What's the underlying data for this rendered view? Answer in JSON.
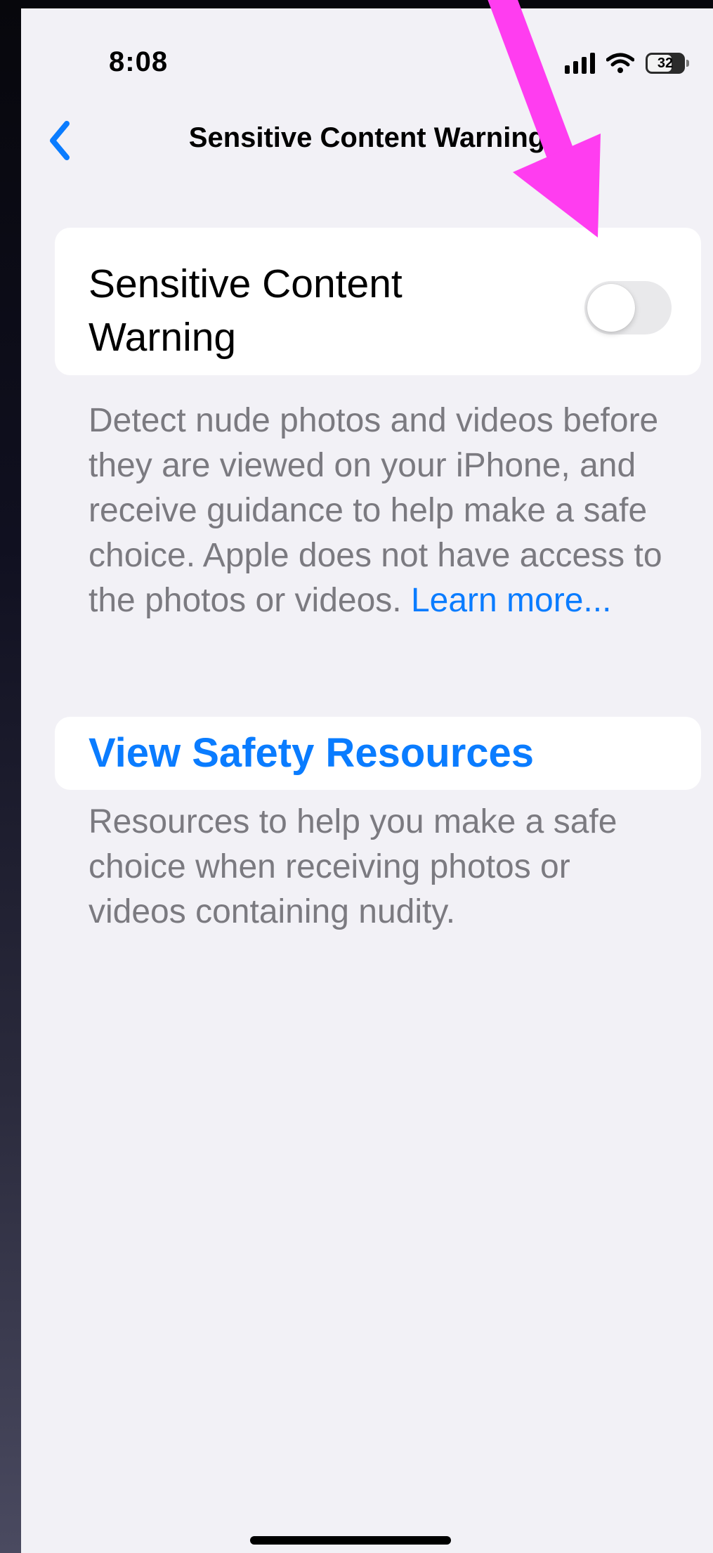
{
  "status_bar": {
    "time": "8:08",
    "battery_level": "32",
    "icons": [
      "signal-icon",
      "wifi-icon",
      "battery-icon"
    ]
  },
  "nav": {
    "title": "Sensitive Content Warning",
    "back_icon": "chevron-left-icon"
  },
  "toggle_section": {
    "label": "Sensitive Content Warning",
    "toggle_on": false,
    "footer": "Detect nude photos and videos before they are viewed on your iPhone, and receive guidance to help make a safe choice. Apple does not have access to the photos or videos.",
    "learn_more": "Learn more..."
  },
  "resources_section": {
    "link_label": "View Safety Resources",
    "footer": "Resources to help you make a safe choice when receiving photos or videos containing nudity."
  },
  "annotation": {
    "type": "arrow-icon",
    "color": "#ff3df0"
  },
  "colors": {
    "accent": "#0a7cff",
    "background": "#f2f1f6",
    "card": "#ffffff",
    "secondary_text": "#7b7a80"
  }
}
